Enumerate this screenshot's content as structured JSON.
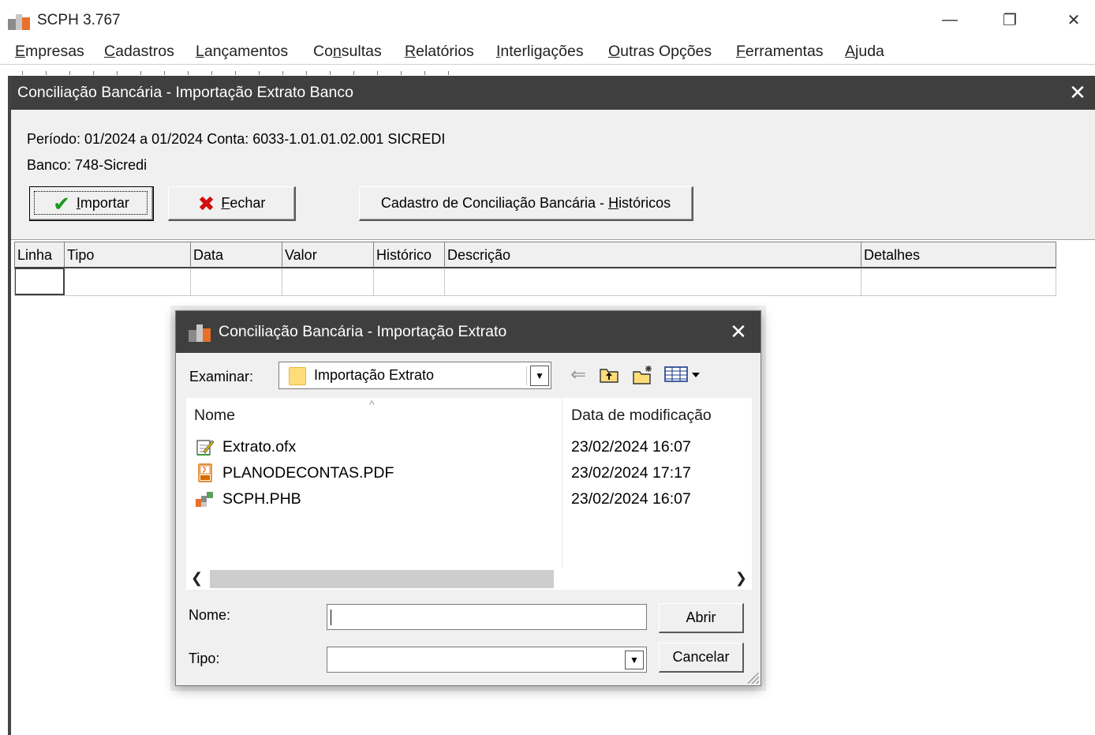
{
  "app": {
    "title": "SCPH 3.767",
    "window_controls": {
      "minimize": "—",
      "maximize": "❐",
      "close": "✕"
    }
  },
  "menu": [
    {
      "u": "E",
      "rest": "mpresas"
    },
    {
      "u": "C",
      "rest": "adastros"
    },
    {
      "u": "L",
      "rest": "ançamentos"
    },
    {
      "pre": "Co",
      "u": "n",
      "rest": "sultas"
    },
    {
      "u": "R",
      "rest": "elatórios"
    },
    {
      "u": "I",
      "rest": "nterligações"
    },
    {
      "u": "O",
      "rest": "utras Opções"
    },
    {
      "u": "F",
      "rest": "erramentas"
    },
    {
      "u": "A",
      "rest": "juda"
    }
  ],
  "conciliacao": {
    "title": "Conciliação Bancária - Importação Extrato Banco",
    "periodo": "Período: 01/2024 a 01/2024  Conta: 6033-1.01.01.02.001 SICREDI",
    "banco": "Banco:  748-Sicredi",
    "buttons": {
      "importar": {
        "u": "I",
        "rest": "mportar"
      },
      "fechar": {
        "u": "F",
        "rest": "echar"
      },
      "cadastro": {
        "pre": "Cadastro de Conciliação Bancária - ",
        "u": "H",
        "rest": "istóricos"
      }
    },
    "grid_columns": [
      "Linha",
      "Tipo",
      "Data",
      "Valor",
      "Histórico",
      "Descrição",
      "Detalhes"
    ]
  },
  "dialog": {
    "title": "Conciliação Bancária - Importação Extrato",
    "examinar_label": "Examinar:",
    "folder": "Importação Extrato",
    "columns": {
      "name": "Nome",
      "date": "Data de modificação"
    },
    "files": [
      {
        "name": "Extrato.ofx",
        "date": "23/02/2024 16:07",
        "icon": "ofx-file-icon"
      },
      {
        "name": "PLANODECONTAS.PDF",
        "date": "23/02/2024 17:17",
        "icon": "pdf-file-icon"
      },
      {
        "name": "SCPH.PHB",
        "date": "23/02/2024 16:07",
        "icon": "scph-file-icon"
      }
    ],
    "nome_label": "Nome:",
    "nome_value": "",
    "tipo_label": "Tipo:",
    "tipo_value": "",
    "abrir": "Abrir",
    "cancelar": "Cancelar"
  },
  "colors": {
    "titlebar_dark": "#3f3f3f",
    "panel_bg": "#f0f0f0",
    "check_green": "#1a9a1a",
    "close_red": "#d01010",
    "folder_yellow": "#fedc7a"
  }
}
